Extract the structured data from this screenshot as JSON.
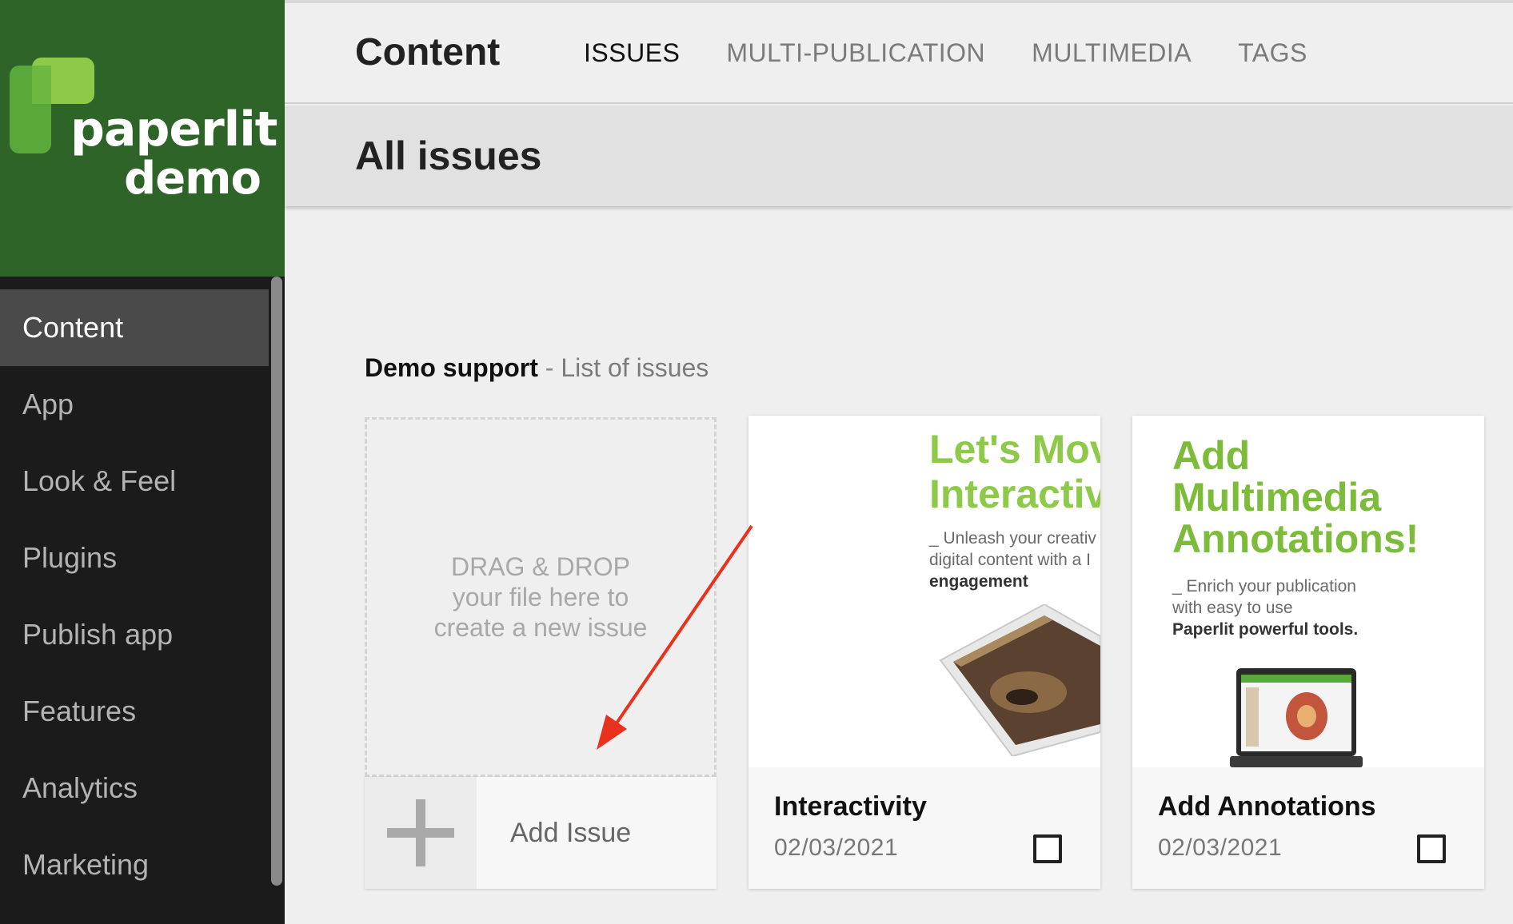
{
  "brand": {
    "name": "paperlit",
    "subname": "demo",
    "colors": {
      "header_bg": "#2e6428",
      "mark_light": "#8fc94a",
      "mark_dark": "#5aa83a"
    }
  },
  "sidebar": {
    "items": [
      {
        "label": "Content",
        "active": true
      },
      {
        "label": "App"
      },
      {
        "label": "Look & Feel"
      },
      {
        "label": "Plugins"
      },
      {
        "label": "Publish app"
      },
      {
        "label": "Features"
      },
      {
        "label": "Analytics"
      },
      {
        "label": "Marketing"
      }
    ]
  },
  "header": {
    "title": "Content",
    "tabs": [
      {
        "label": "ISSUES",
        "active": true
      },
      {
        "label": "MULTI-PUBLICATION"
      },
      {
        "label": "MULTIMEDIA"
      },
      {
        "label": "TAGS"
      }
    ]
  },
  "subheader": {
    "title": "All issues"
  },
  "section": {
    "publication": "Demo support",
    "separator": " - ",
    "subtitle": "List of issues"
  },
  "dropzone": {
    "line1": "DRAG & DROP",
    "line2": "your file here to",
    "line3": "create a new issue"
  },
  "add_issue": {
    "label": "Add Issue",
    "icon": "plus-icon"
  },
  "issues": [
    {
      "title": "Interactivity",
      "date": "02/03/2021",
      "checked": false,
      "cover": {
        "heading_line1": "Let's Mov",
        "heading_line2": "Interactiv",
        "body_line1": "_ Unleash your creativ",
        "body_line2": "digital content with a I",
        "body_line3": "engagement"
      }
    },
    {
      "title": "Add Annotations",
      "date": "02/03/2021",
      "checked": false,
      "cover": {
        "heading_line1": "Add",
        "heading_line2": "Multimedia",
        "heading_line3": "Annotations!",
        "body_line1": "_ Enrich your publication",
        "body_line2": "with easy to use",
        "body_line3": "Paperlit powerful tools."
      }
    }
  ],
  "annotation": {
    "color": "#e8321e"
  }
}
